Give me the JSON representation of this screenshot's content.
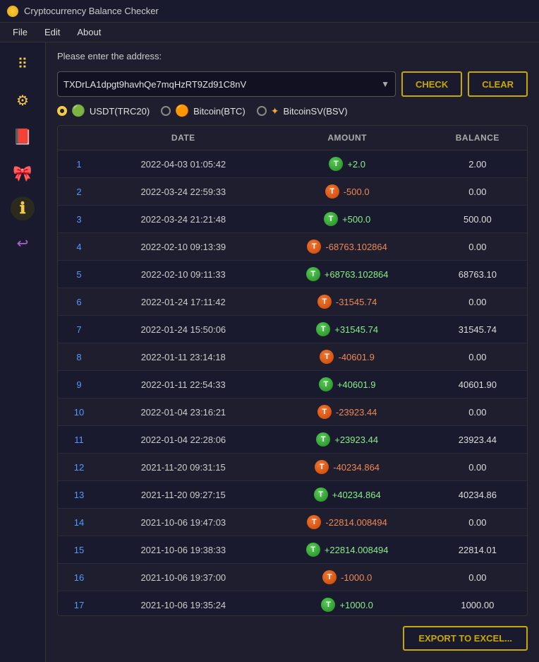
{
  "titleBar": {
    "title": "Cryptocurrency Balance Checker"
  },
  "menuBar": {
    "items": [
      "File",
      "Edit",
      "About"
    ]
  },
  "sidebar": {
    "icons": [
      {
        "name": "grid-icon",
        "symbol": "⠿",
        "color": "#f7c948"
      },
      {
        "name": "settings-icon",
        "symbol": "⚙",
        "color": "#f7c948"
      },
      {
        "name": "book-icon",
        "symbol": "📕",
        "color": "#cc3333"
      },
      {
        "name": "gift-icon",
        "symbol": "🎀",
        "color": "#cc6699"
      },
      {
        "name": "info-icon",
        "symbol": "ℹ",
        "color": "#f7c948"
      },
      {
        "name": "logout-icon",
        "symbol": "↩",
        "color": "#aa66cc"
      }
    ]
  },
  "content": {
    "promptLabel": "Please enter the address:",
    "addressValue": "TXDrLA1dpgt9havhQe7mqHzRT9Zd91C8nV",
    "checkButton": "CHECK",
    "clearButton": "CLEAR",
    "coins": [
      {
        "id": "usdt",
        "label": "USDT(TRC20)",
        "selected": true,
        "color": "#22aa66"
      },
      {
        "id": "btc",
        "label": "Bitcoin(BTC)",
        "selected": false,
        "color": "#f7a535"
      },
      {
        "id": "bsv",
        "label": "BitcoinSV(BSV)",
        "selected": false,
        "color": "#f7a535"
      }
    ],
    "table": {
      "columns": [
        "",
        "DATE",
        "AMOUNT",
        "BALANCE"
      ],
      "rows": [
        {
          "num": 1,
          "date": "2022-04-03 01:05:42",
          "amount": "+2.0",
          "positive": true,
          "balance": "2.00"
        },
        {
          "num": 2,
          "date": "2022-03-24 22:59:33",
          "amount": "-500.0",
          "positive": false,
          "balance": "0.00"
        },
        {
          "num": 3,
          "date": "2022-03-24 21:21:48",
          "amount": "+500.0",
          "positive": true,
          "balance": "500.00"
        },
        {
          "num": 4,
          "date": "2022-02-10 09:13:39",
          "amount": "-68763.102864",
          "positive": false,
          "balance": "0.00"
        },
        {
          "num": 5,
          "date": "2022-02-10 09:11:33",
          "amount": "+68763.102864",
          "positive": true,
          "balance": "68763.10"
        },
        {
          "num": 6,
          "date": "2022-01-24 17:11:42",
          "amount": "-31545.74",
          "positive": false,
          "balance": "0.00"
        },
        {
          "num": 7,
          "date": "2022-01-24 15:50:06",
          "amount": "+31545.74",
          "positive": true,
          "balance": "31545.74"
        },
        {
          "num": 8,
          "date": "2022-01-11 23:14:18",
          "amount": "-40601.9",
          "positive": false,
          "balance": "0.00"
        },
        {
          "num": 9,
          "date": "2022-01-11 22:54:33",
          "amount": "+40601.9",
          "positive": true,
          "balance": "40601.90"
        },
        {
          "num": 10,
          "date": "2022-01-04 23:16:21",
          "amount": "-23923.44",
          "positive": false,
          "balance": "0.00"
        },
        {
          "num": 11,
          "date": "2022-01-04 22:28:06",
          "amount": "+23923.44",
          "positive": true,
          "balance": "23923.44"
        },
        {
          "num": 12,
          "date": "2021-11-20 09:31:15",
          "amount": "-40234.864",
          "positive": false,
          "balance": "0.00"
        },
        {
          "num": 13,
          "date": "2021-11-20 09:27:15",
          "amount": "+40234.864",
          "positive": true,
          "balance": "40234.86"
        },
        {
          "num": 14,
          "date": "2021-10-06 19:47:03",
          "amount": "-22814.008494",
          "positive": false,
          "balance": "0.00"
        },
        {
          "num": 15,
          "date": "2021-10-06 19:38:33",
          "amount": "+22814.008494",
          "positive": true,
          "balance": "22814.01"
        },
        {
          "num": 16,
          "date": "2021-10-06 19:37:00",
          "amount": "-1000.0",
          "positive": false,
          "balance": "0.00"
        },
        {
          "num": 17,
          "date": "2021-10-06 19:35:24",
          "amount": "+1000.0",
          "positive": true,
          "balance": "1000.00"
        }
      ]
    },
    "exportButton": "EXPORT TO EXCEL..."
  }
}
